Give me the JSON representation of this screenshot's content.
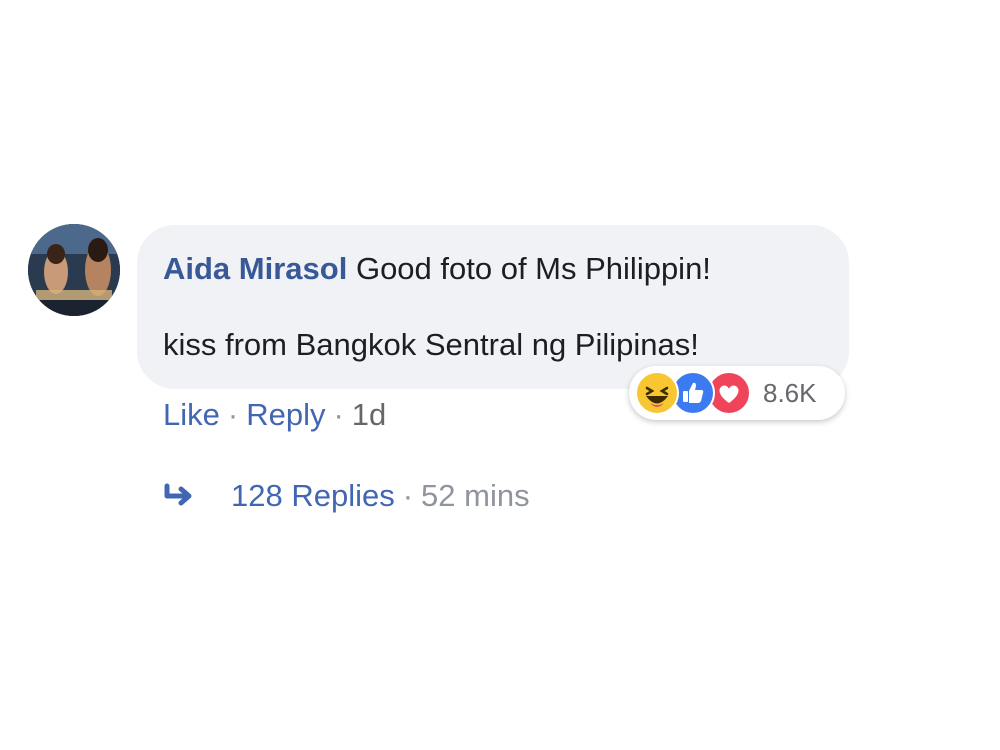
{
  "comment": {
    "author": "Aida Mirasol",
    "text_line1": "Good foto of Ms Philippin!",
    "text_line2": "kiss from Bangkok Sentral ng Pilipinas!"
  },
  "reactions": {
    "icons": [
      "haha-icon",
      "like-icon",
      "love-icon"
    ],
    "count": "8.6K",
    "colors": {
      "haha": "#f7c631",
      "like": "#3b7af0",
      "love": "#f0445b"
    }
  },
  "actions": {
    "like_label": "Like",
    "reply_label": "Reply",
    "time": "1d",
    "separator": "·"
  },
  "replies": {
    "label": "128 Replies",
    "time": "52 mins",
    "separator": "·"
  },
  "colors": {
    "link": "#4267b2",
    "author": "#385898",
    "bubble": "#f0f2f5"
  }
}
